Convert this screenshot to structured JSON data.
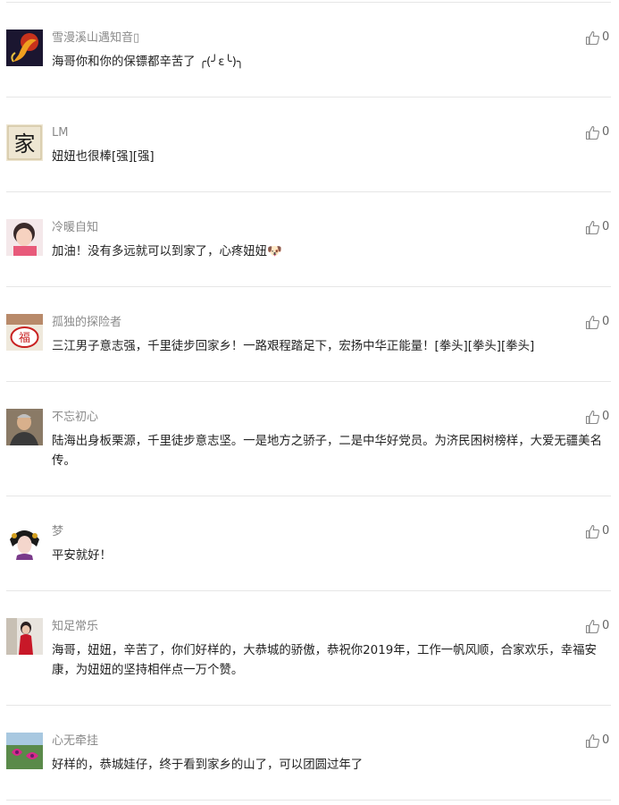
{
  "comments": [
    {
      "username": "雪漫溪山遇知音▯",
      "text": "海哥你和你的保镖都辛苦了 ╭(╯ε╰)╮",
      "likes": "0",
      "avatar": "fish-avatar"
    },
    {
      "username": "LM",
      "text": "妞妞也很棒[强][强]",
      "likes": "0",
      "avatar": "calligraphy-jia-avatar"
    },
    {
      "username": "冷暖自知",
      "text": "加油！没有多远就可以到家了，心疼妞妞🐶",
      "likes": "0",
      "avatar": "child-avatar"
    },
    {
      "username": "孤独的探险者",
      "text": "三江男子意志强，千里徒步回家乡！一路艰程踏足下，宏扬中华正能量！[拳头][拳头][拳头]",
      "likes": "0",
      "avatar": "fu-avatar"
    },
    {
      "username": "不忘初心",
      "text": "陆海出身板栗源，千里徒步意志坚。一是地方之骄子，二是中华好党员。为济民困树榜样，大爱无疆美名传。",
      "likes": "0",
      "avatar": "man-avatar"
    },
    {
      "username": "梦",
      "text": "平安就好！",
      "likes": "0",
      "avatar": "opera-avatar"
    },
    {
      "username": "知足常乐",
      "text": "海哥，妞妞，辛苦了，你们好样的，大恭城的骄傲，恭祝你2019年，工作一帆风顺，合家欢乐，幸福安康，为妞妞的坚持相伴点一万个赞。",
      "likes": "0",
      "avatar": "woman-avatar"
    },
    {
      "username": "心无牵挂",
      "text": "好样的，恭城娃仔，终于看到家乡的山了，可以团圆过年了",
      "likes": "0",
      "avatar": "flower-avatar"
    }
  ],
  "colors": {
    "username": "#8a8a8a",
    "text": "#222222",
    "divider": "#e6e6e6",
    "like_icon": "#888888"
  },
  "icons": {
    "like": "thumbs-up-icon"
  }
}
